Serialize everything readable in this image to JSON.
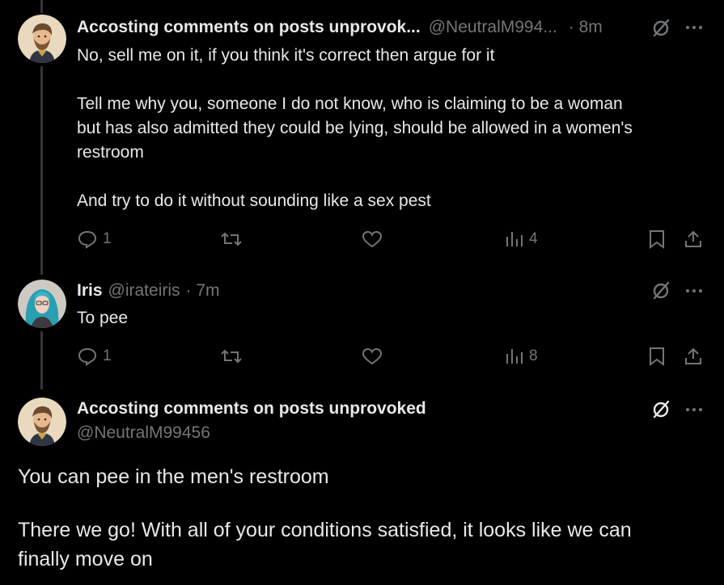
{
  "tweets": [
    {
      "name": "Accosting comments on posts unprovok...",
      "handle": "@NeutralM994...",
      "time": "· 8m",
      "lines": [
        "No, sell me on it, if you think it's correct then argue for it",
        "",
        "Tell me why you, someone I do not know, who is claiming to be a woman",
        "but has also admitted they could be lying, should be allowed in a women's",
        "restroom",
        "",
        "And try to do it without sounding like a sex pest"
      ],
      "replies": "1",
      "views": "4"
    },
    {
      "name": "Iris",
      "handle": "@irateiris",
      "time": "· 7m",
      "lines": [
        "To pee"
      ],
      "replies": "1",
      "views": "8"
    },
    {
      "name": "Accosting comments on posts unprovoked",
      "handle": "@NeutralM99456",
      "lines": [
        "You can pee in the men's restroom",
        "",
        "There we go! With all of your conditions satisfied, it looks like we can",
        "finally move on"
      ]
    }
  ],
  "icons": [
    "reply-icon",
    "retweet-icon",
    "like-icon",
    "views-icon",
    "bookmark-icon",
    "share-icon",
    "grok-icon",
    "more-icon"
  ],
  "colors": {
    "background": "#000000",
    "text": "#e7e9ea",
    "muted": "#71767b",
    "thread_line": "#333639"
  }
}
